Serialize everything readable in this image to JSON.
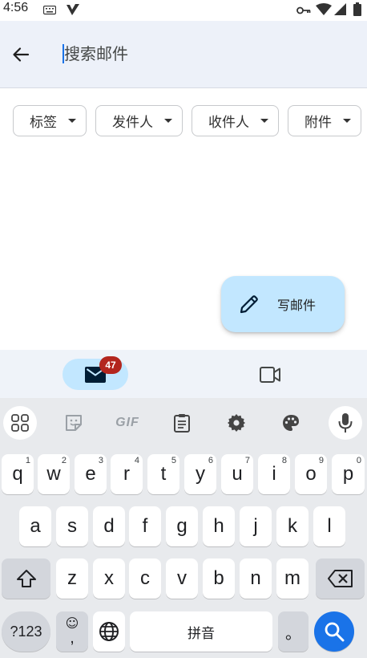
{
  "status_bar": {
    "time": "4:56"
  },
  "search": {
    "placeholder": "搜索邮件",
    "value": ""
  },
  "filters": [
    {
      "label": "标签"
    },
    {
      "label": "发件人"
    },
    {
      "label": "收件人"
    },
    {
      "label": "附件"
    }
  ],
  "fab": {
    "label": "写邮件",
    "icon": "pencil-icon"
  },
  "bottom_nav": {
    "mail_badge": "47",
    "mail_icon": "mail-icon",
    "meet_icon": "video-icon"
  },
  "keyboard": {
    "toolbar": [
      "apps-grid-icon",
      "sticker-icon",
      "gif-icon",
      "clipboard-icon",
      "settings-icon",
      "palette-icon",
      "mic-icon"
    ],
    "gif_label": "GIF",
    "row1": [
      {
        "k": "q",
        "h": "1"
      },
      {
        "k": "w",
        "h": "2"
      },
      {
        "k": "e",
        "h": "3"
      },
      {
        "k": "r",
        "h": "4"
      },
      {
        "k": "t",
        "h": "5"
      },
      {
        "k": "y",
        "h": "6"
      },
      {
        "k": "u",
        "h": "7"
      },
      {
        "k": "i",
        "h": "8"
      },
      {
        "k": "o",
        "h": "9"
      },
      {
        "k": "p",
        "h": "0"
      }
    ],
    "row2": [
      "a",
      "s",
      "d",
      "f",
      "g",
      "h",
      "j",
      "k",
      "l"
    ],
    "row3": [
      "z",
      "x",
      "c",
      "v",
      "b",
      "n",
      "m"
    ],
    "symbols_label": "?123",
    "emoji_top": "☺",
    "emoji_bottom": ",",
    "space_label": "拼音",
    "period_label": "。"
  }
}
